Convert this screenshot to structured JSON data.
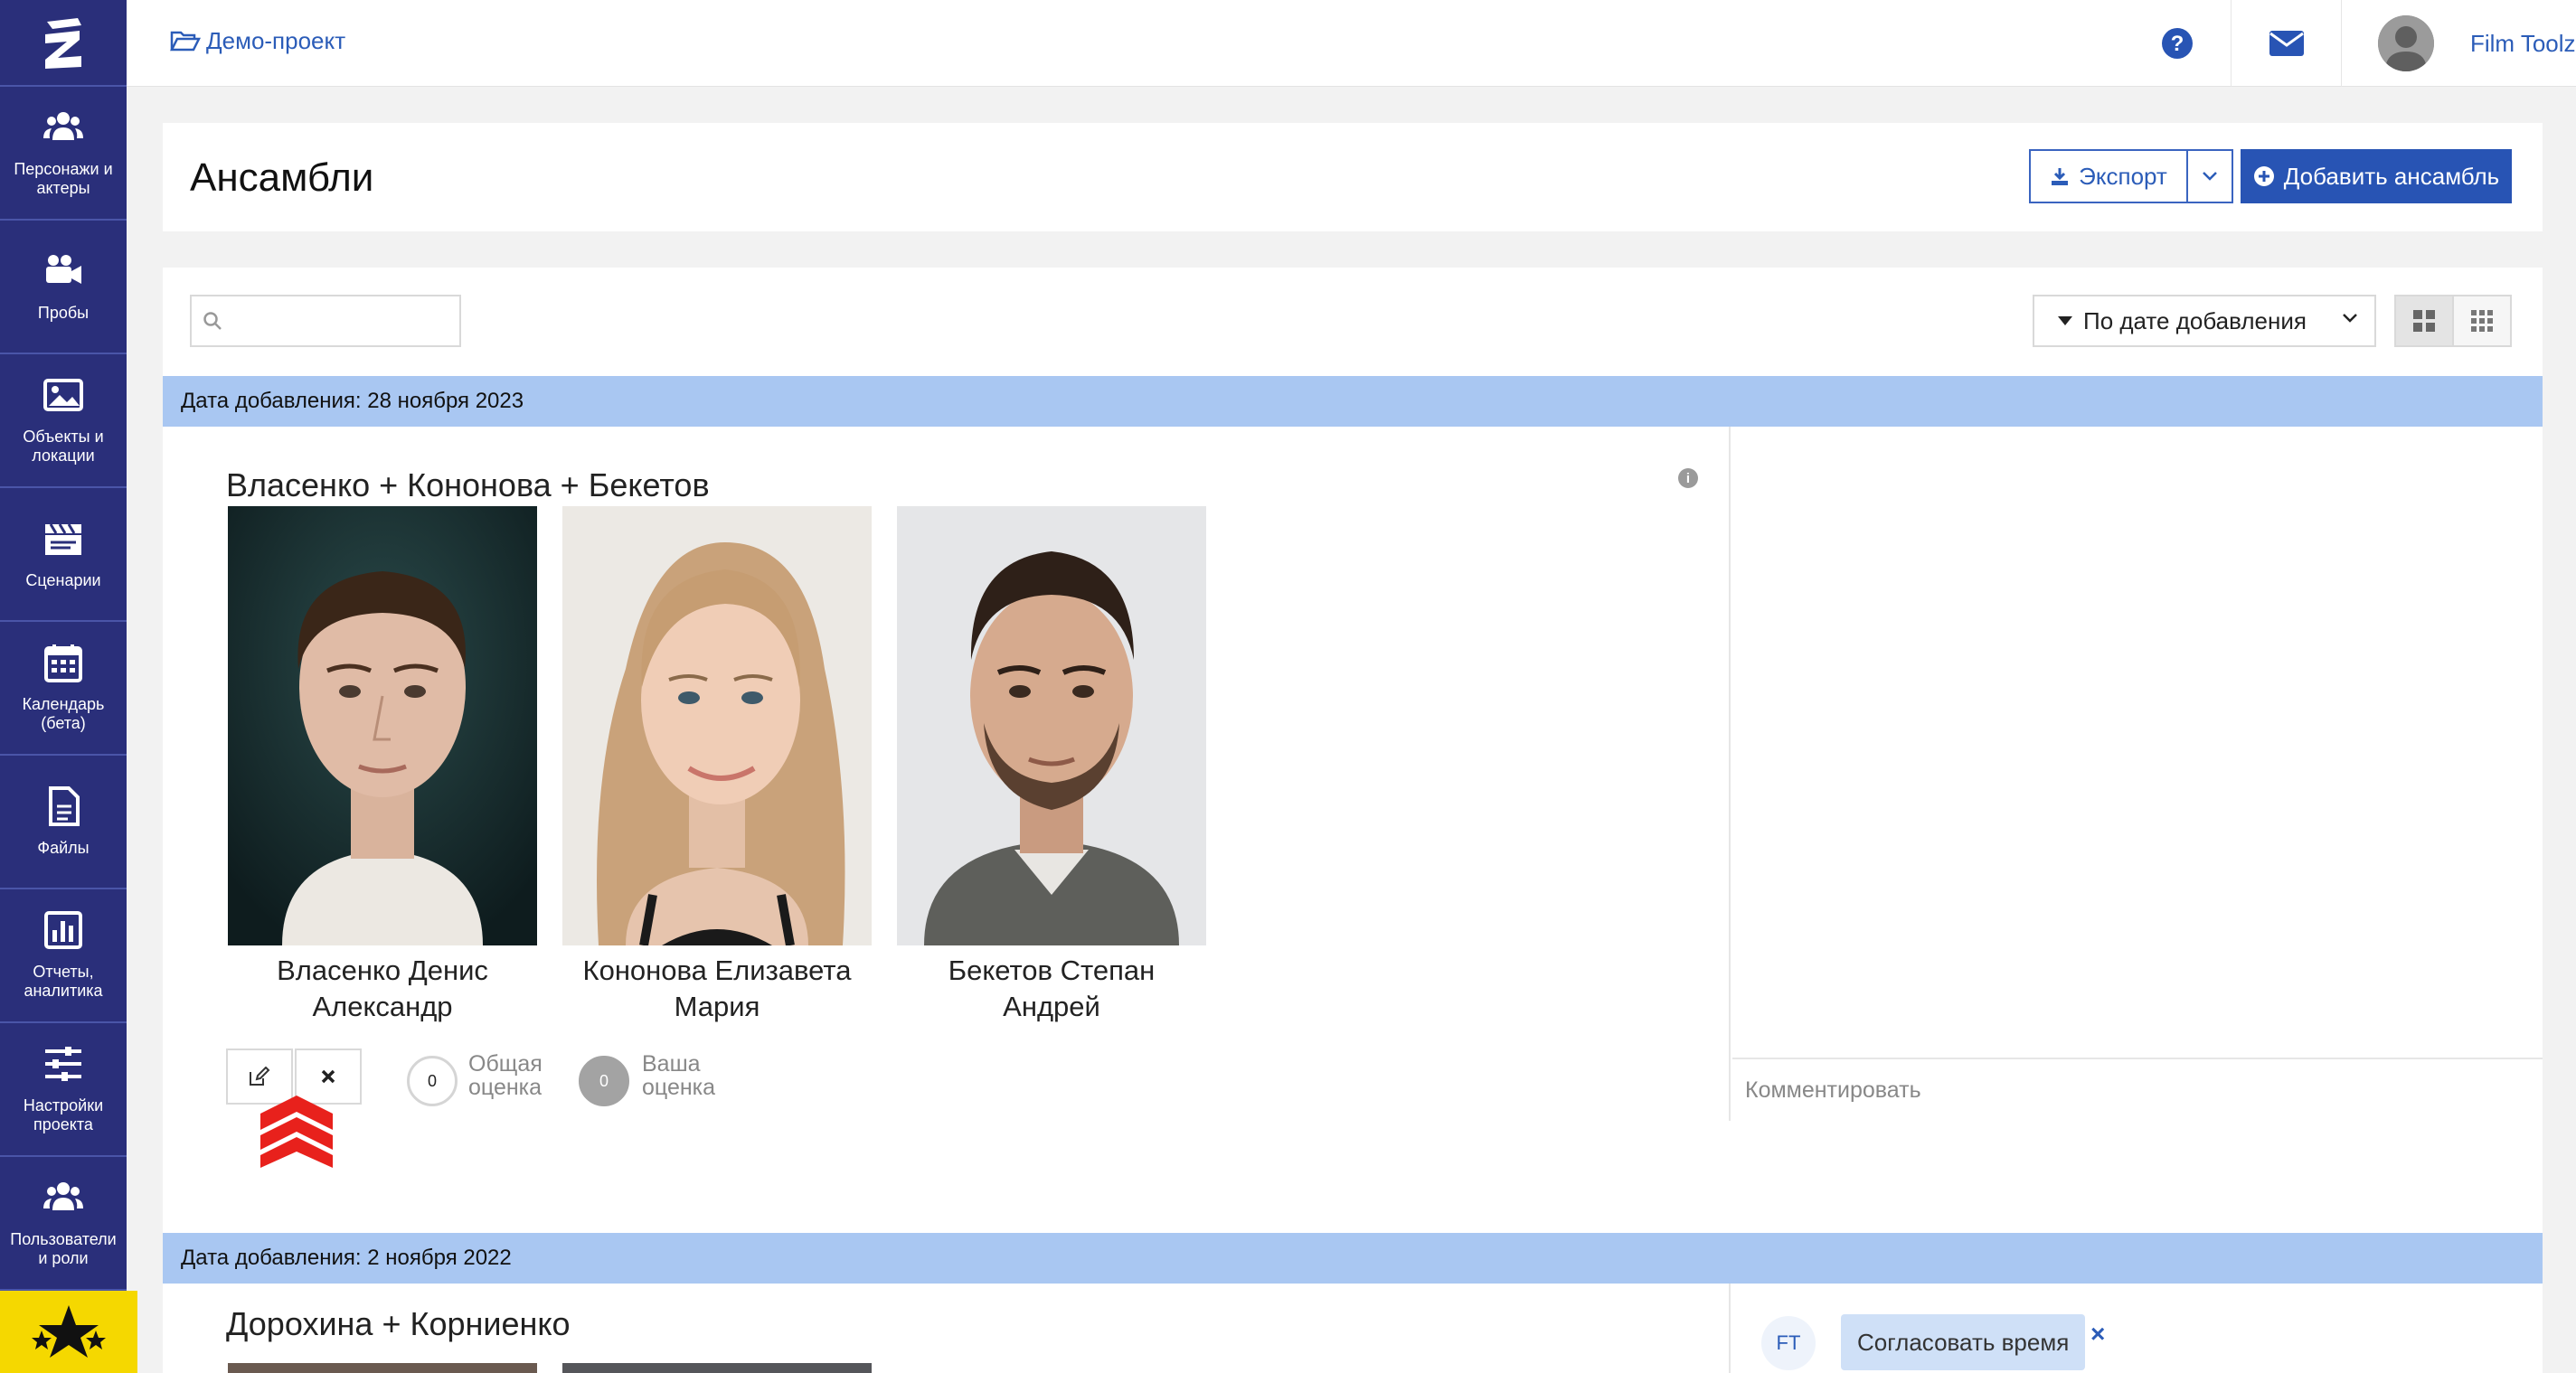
{
  "sidebar": {
    "items": [
      {
        "label": "Персонажи и актеры",
        "icon": "users-icon"
      },
      {
        "label": "Пробы",
        "icon": "video-camera-icon"
      },
      {
        "label": "Объекты и локации",
        "icon": "image-icon"
      },
      {
        "label": "Сценарии",
        "icon": "clapperboard-icon"
      },
      {
        "label": "Календарь (бета)",
        "icon": "calendar-icon"
      },
      {
        "label": "Файлы",
        "icon": "file-icon"
      },
      {
        "label": "Отчеты, аналитика",
        "icon": "bar-chart-icon"
      },
      {
        "label": "Настройки проекта",
        "icon": "sliders-icon"
      },
      {
        "label": "Пользователи и роли",
        "icon": "users-icon"
      }
    ]
  },
  "topbar": {
    "breadcrumb": "Демо-проект",
    "user_name": "Film Toolz"
  },
  "header": {
    "title": "Ансамбли",
    "export_label": "Экспорт",
    "add_label": "Добавить ансамбль"
  },
  "toolbar": {
    "search_placeholder": "",
    "sort_label": "По дате добавления"
  },
  "groups": [
    {
      "date_label": "Дата добавления: 28 ноября 2023",
      "ensemble_title": "Власенко + Кононова + Бекетов",
      "actors": [
        {
          "name_line1": "Власенко Денис",
          "name_line2": "Александр"
        },
        {
          "name_line1": "Кононова Елизавета",
          "name_line2": "Мария"
        },
        {
          "name_line1": "Бекетов Степан",
          "name_line2": "Андрей"
        }
      ],
      "overall_score": "0",
      "overall_label_1": "Общая",
      "overall_label_2": "оценка",
      "your_score": "0",
      "your_label_1": "Ваша",
      "your_label_2": "оценка",
      "comment_placeholder": "Комментировать"
    },
    {
      "date_label": "Дата добавления: 2 ноября 2022",
      "ensemble_title": "Дорохина + Корниенко",
      "tag_initials": "FT",
      "tag_label": "Согласовать время",
      "tag_remove": "×"
    }
  ],
  "colors": {
    "sidebar_bg": "#2a2f7a",
    "accent": "#2854b4",
    "date_bar": "#a9c7f2",
    "annotation_arrow": "#e8211c",
    "star_bg": "#f5d800"
  }
}
